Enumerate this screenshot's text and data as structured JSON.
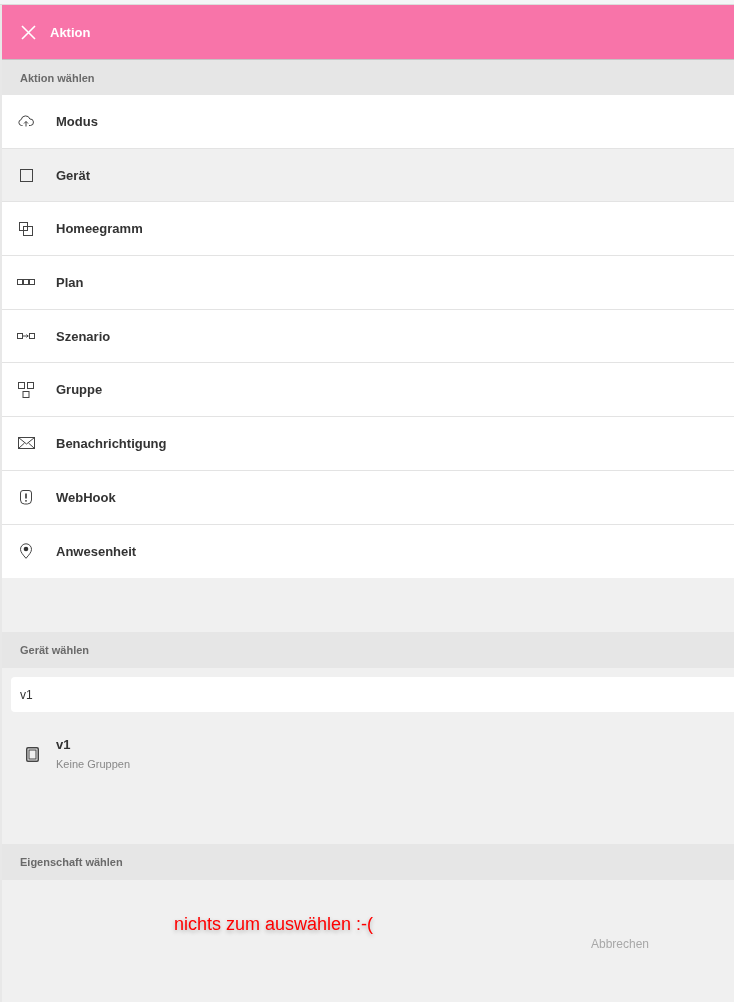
{
  "header": {
    "title": "Aktion"
  },
  "sections": [
    {
      "kind": "actions",
      "title": "Aktion wählen",
      "items": [
        {
          "label": "Modus",
          "selected": false
        },
        {
          "label": "Gerät",
          "selected": true
        },
        {
          "label": "Homeegramm",
          "selected": false
        },
        {
          "label": "Plan",
          "selected": false
        },
        {
          "label": "Szenario",
          "selected": false
        },
        {
          "label": "Gruppe",
          "selected": false
        },
        {
          "label": "Benachrichtigung",
          "selected": false
        },
        {
          "label": "WebHook",
          "selected": false
        },
        {
          "label": "Anwesenheit",
          "selected": false
        }
      ]
    },
    {
      "kind": "devices",
      "title": "Gerät wählen",
      "search": {
        "value": "v1"
      },
      "results": [
        {
          "name": "v1",
          "subtitle": "Keine Gruppen"
        }
      ]
    },
    {
      "kind": "properties",
      "title": "Eigenschaft wählen",
      "annotation": "nichts zum auswählen :-(",
      "buttons": [
        {
          "label": "Abbrechen"
        }
      ]
    }
  ]
}
